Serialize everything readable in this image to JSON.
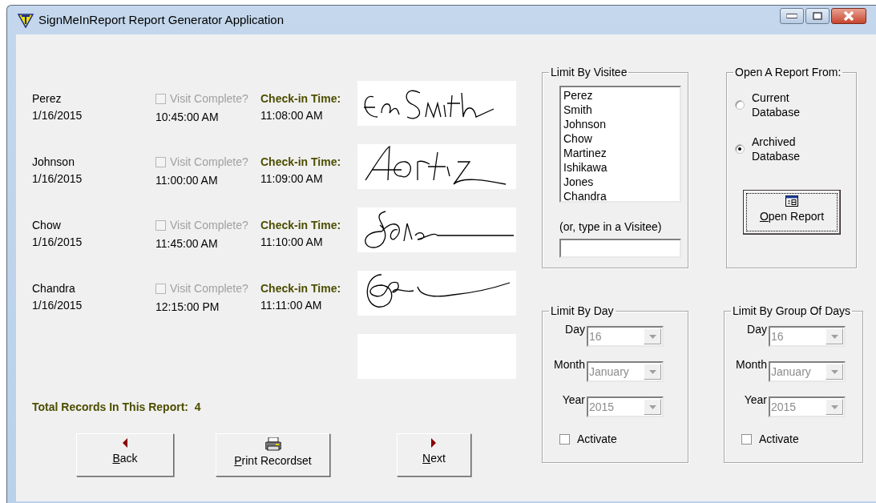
{
  "window": {
    "title": "SignMeInReport Report Generator Application"
  },
  "records": [
    {
      "name": "Perez",
      "date": "1/16/2015",
      "visit_complete_label": "Visit Complete?",
      "visit_complete": false,
      "disabled": true,
      "time": "10:45:00 AM",
      "checkin_label": "Check-in Time:",
      "checkin_time": "11:08:00 AM"
    },
    {
      "name": "Johnson",
      "date": "1/16/2015",
      "visit_complete_label": "Visit Complete?",
      "visit_complete": false,
      "disabled": true,
      "time": "11:00:00 AM",
      "checkin_label": "Check-in Time:",
      "checkin_time": "11:09:00 AM"
    },
    {
      "name": "Chow",
      "date": "1/16/2015",
      "visit_complete_label": "Visit Complete?",
      "visit_complete": false,
      "disabled": true,
      "time": "11:45:00 AM",
      "checkin_label": "Check-in Time:",
      "checkin_time": "11:10:00 AM"
    },
    {
      "name": "Chandra",
      "date": "1/16/2015",
      "visit_complete_label": "Visit Complete?",
      "visit_complete": false,
      "disabled": true,
      "time": "12:15:00 PM",
      "checkin_label": "Check-in Time:",
      "checkin_time": "11:11:00 AM"
    }
  ],
  "total_records": "Total Records In This Report:  4",
  "nav_buttons": [
    {
      "label": "Back",
      "kind": "back"
    },
    {
      "label": "Print Recordset",
      "kind": "print"
    },
    {
      "label": "Next",
      "kind": "next"
    }
  ],
  "visitee_filter": {
    "title": "Limit By Visitee",
    "items": [
      {
        "label": "Perez",
        "selected": false
      },
      {
        "label": "Smith",
        "selected": false
      },
      {
        "label": "Johnson",
        "selected": false
      },
      {
        "label": "Chow",
        "selected": false
      },
      {
        "label": "Martinez",
        "selected": false
      },
      {
        "label": "Ishikawa",
        "selected": false
      },
      {
        "label": "Jones",
        "selected": false
      },
      {
        "label": "Chandra",
        "selected": false
      }
    ],
    "hint": "(or, type in a Visitee)"
  },
  "report_source": {
    "title": "Open A Report From:",
    "options": [
      {
        "label": "Current Database",
        "selected": false
      },
      {
        "label": "Archived Database",
        "selected": true
      }
    ],
    "button": {
      "label": "Open Report"
    }
  },
  "day_filter": {
    "title": "Limit By Day",
    "fields": [
      {
        "label": "Day",
        "value": "16",
        "disabled": true
      },
      {
        "label": "Month",
        "value": "January",
        "disabled": true
      },
      {
        "label": "Year",
        "value": "2015",
        "disabled": true
      }
    ],
    "activate": {
      "label": "Activate",
      "checked": false
    }
  },
  "group_filter": {
    "title": "Limit By Group Of Days",
    "fields": [
      {
        "label": "Day",
        "value": "16",
        "disabled": true
      },
      {
        "label": "Month",
        "value": "January",
        "disabled": true
      },
      {
        "label": "Year",
        "value": "2015",
        "disabled": true
      }
    ],
    "activate": {
      "label": "Activate",
      "checked": false
    }
  }
}
